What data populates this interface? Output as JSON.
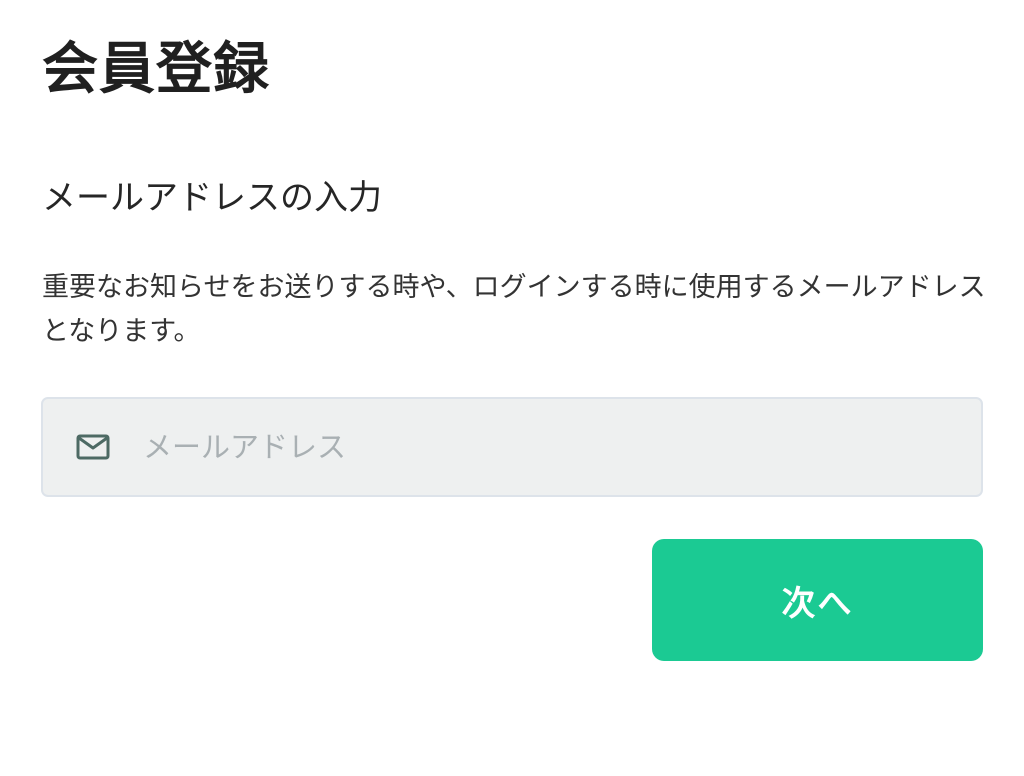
{
  "header": {
    "title": "会員登録"
  },
  "section": {
    "title": "メールアドレスの入力",
    "description": "重要なお知らせをお送りする時や、ログインする時に使用するメールアドレスとなります。"
  },
  "email_field": {
    "value": "",
    "placeholder": "メールアドレス",
    "icon": "mail-icon"
  },
  "next_button": {
    "label": "次へ"
  },
  "colors": {
    "accent": "#1bca93",
    "input_background": "#eef0f0",
    "input_border": "#dde3ea",
    "icon": "#4d6a64",
    "placeholder": "#a9b0b3"
  }
}
